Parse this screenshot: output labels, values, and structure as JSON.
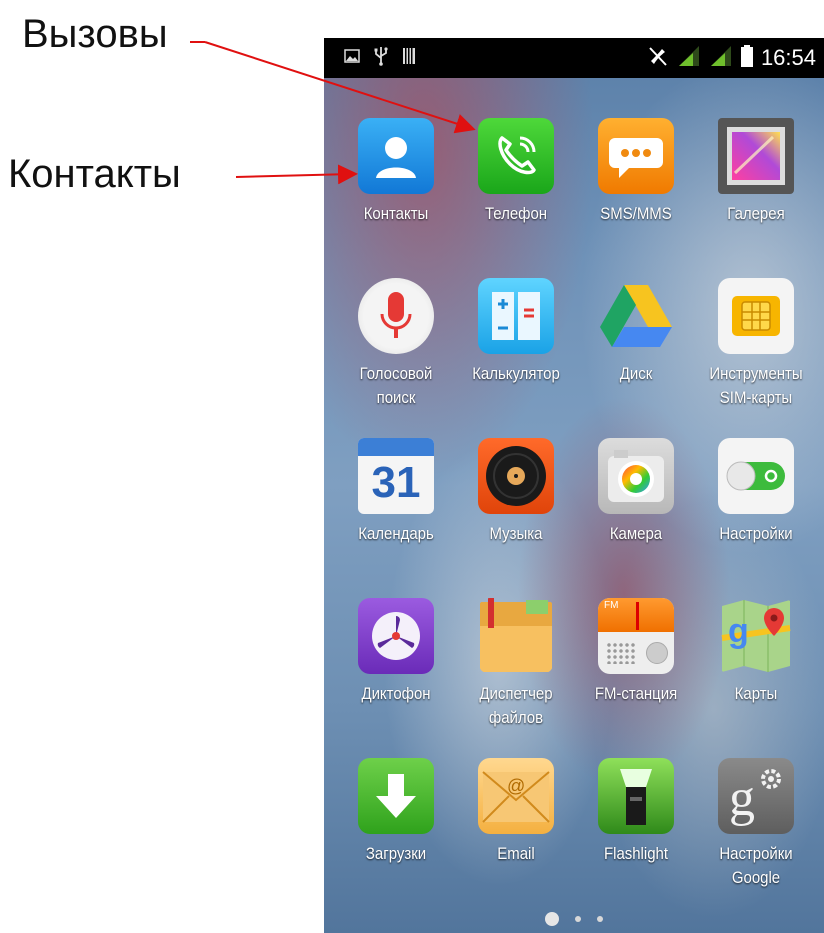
{
  "annotations": {
    "calls_label": "Вызовы",
    "contacts_label": "Контакты",
    "arrow_color": "#e01010"
  },
  "status_bar": {
    "time": "16:54",
    "left_icons": [
      "image-icon",
      "usb-icon",
      "storage-icon"
    ],
    "right_icons": [
      "mute-icon",
      "signal-icon",
      "signal-icon",
      "battery-icon"
    ]
  },
  "apps": [
    {
      "label": "Контакты",
      "label2": "",
      "icon": "contacts-icon"
    },
    {
      "label": "Телефон",
      "label2": "",
      "icon": "phone-icon"
    },
    {
      "label": "SMS/MMS",
      "label2": "",
      "icon": "sms-icon"
    },
    {
      "label": "Галерея",
      "label2": "",
      "icon": "gallery-icon"
    },
    {
      "label": "Голосовой",
      "label2": "поиск",
      "icon": "microphone-icon"
    },
    {
      "label": "Калькулятор",
      "label2": "",
      "icon": "calculator-icon"
    },
    {
      "label": "Диск",
      "label2": "",
      "icon": "drive-icon"
    },
    {
      "label": "Инструменты",
      "label2": "SIM-карты",
      "icon": "sim-card-icon"
    },
    {
      "label": "Календарь",
      "label2": "",
      "icon": "calendar-icon",
      "calendar_day": "31"
    },
    {
      "label": "Музыка",
      "label2": "",
      "icon": "music-icon"
    },
    {
      "label": "Камера",
      "label2": "",
      "icon": "camera-icon"
    },
    {
      "label": "Настройки",
      "label2": "",
      "icon": "settings-toggle-icon"
    },
    {
      "label": "Диктофон",
      "label2": "",
      "icon": "recorder-icon"
    },
    {
      "label": "Диспетчер",
      "label2": "файлов",
      "icon": "file-manager-icon"
    },
    {
      "label": "FM-станция",
      "label2": "",
      "icon": "fm-radio-icon",
      "fm_text": "FM"
    },
    {
      "label": "Карты",
      "label2": "",
      "icon": "maps-icon"
    },
    {
      "label": "Загрузки",
      "label2": "",
      "icon": "download-icon"
    },
    {
      "label": "Email",
      "label2": "",
      "icon": "email-icon"
    },
    {
      "label": "Flashlight",
      "label2": "",
      "icon": "flashlight-icon"
    },
    {
      "label": "Настройки",
      "label2": "Google",
      "icon": "google-settings-icon"
    }
  ],
  "page_indicator": {
    "pages": 3,
    "current": 1
  }
}
